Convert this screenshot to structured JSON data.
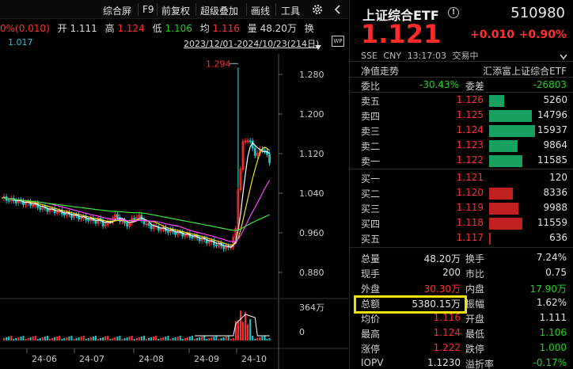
{
  "toolbar": {
    "items": [
      "综合屏",
      "F9",
      "前复权",
      "超级叠加",
      "画线",
      "工具"
    ],
    "settings_icon": "gear-icon",
    "collapse_icon": "chevron-left-icon"
  },
  "quote_line": {
    "change": "0%(0.010)",
    "open_label": "开",
    "open": "1.111",
    "high_label": "高",
    "high": "1.124",
    "low_label": "低",
    "low": "1.106",
    "avg_label": "均",
    "avg": "1.116",
    "vol_label": "量",
    "vol": "48.20万",
    "more": "换"
  },
  "sub_line": {
    "ma_value": "1.017",
    "date_range": "2023/12/01-2024/10/23(214日)"
  },
  "chart": {
    "peak_label": "1.294",
    "y_ticks": [
      "1.280",
      "1.200",
      "1.120",
      "1.040",
      "0.960",
      "0.880"
    ],
    "vol_ticks": [
      "364万",
      "0"
    ],
    "x_ticks": [
      "24-06",
      "24-07",
      "24-08",
      "24-09",
      "24-10"
    ],
    "colors": {
      "up": "#ff3030",
      "down": "#18c8c8",
      "ma5": "#ffffff",
      "ma10": "#f0e020",
      "ma20": "#ff40ff",
      "ma60": "#40e040"
    }
  },
  "right_panel": {
    "title": "上证综合ETF",
    "code": "510980",
    "price": "1.121",
    "change": "+0.010",
    "change_pct": "+0.90%",
    "exchange": "SSE",
    "currency": "CNY",
    "time": "13:17:03",
    "status": "交易中",
    "section": "净值走势",
    "fund_name": "汇添富上证综合ETF",
    "weibi_label": "委比",
    "weibi": "-30.43%",
    "weicha_label": "委差",
    "weicha": "-26803",
    "asks": [
      {
        "label": "卖五",
        "price": "1.126",
        "volume": "5260",
        "ratio": 0.33
      },
      {
        "label": "卖四",
        "price": "1.125",
        "volume": "14796",
        "ratio": 0.93
      },
      {
        "label": "卖三",
        "price": "1.124",
        "volume": "15937",
        "ratio": 1.0
      },
      {
        "label": "卖二",
        "price": "1.123",
        "volume": "9864",
        "ratio": 0.62
      },
      {
        "label": "卖一",
        "price": "1.122",
        "volume": "11585",
        "ratio": 0.73
      }
    ],
    "bids": [
      {
        "label": "买一",
        "price": "1.121",
        "volume": "120",
        "ratio": 0.0
      },
      {
        "label": "买二",
        "price": "1.120",
        "volume": "8336",
        "ratio": 0.52
      },
      {
        "label": "买三",
        "price": "1.119",
        "volume": "9988",
        "ratio": 0.63
      },
      {
        "label": "买四",
        "price": "1.118",
        "volume": "11559",
        "ratio": 0.73
      },
      {
        "label": "买五",
        "price": "1.117",
        "volume": "636",
        "ratio": 0.04
      }
    ],
    "stats": [
      {
        "l1": "总量",
        "v1": "48.20万",
        "c1": "#e0e0e0",
        "l2": "换手",
        "v2": "7.24%",
        "c2": "#e0e0e0"
      },
      {
        "l1": "现手",
        "v1": "200",
        "c1": "#e0e0e0",
        "l2": "市比",
        "v2": "0.75",
        "c2": "#e0e0e0"
      },
      {
        "l1": "外盘",
        "v1": "30.30万",
        "c1": "#ff3030",
        "l2": "内盘",
        "v2": "17.90万",
        "c2": "#20d020"
      },
      {
        "l1": "总额",
        "v1": "5380.15万",
        "c1": "#e0e0e0",
        "l2": "振幅",
        "v2": "1.62%",
        "c2": "#e0e0e0"
      },
      {
        "l1": "均价",
        "v1": "1.116",
        "c1": "#ff3030",
        "l2": "开盘",
        "v2": "1.111",
        "c2": "#e0e0e0"
      },
      {
        "l1": "最高",
        "v1": "1.124",
        "c1": "#ff3030",
        "l2": "最低",
        "v2": "1.106",
        "c2": "#20d020"
      },
      {
        "l1": "涨停",
        "v1": "1.222",
        "c1": "#ff3030",
        "l2": "跌停",
        "v2": "1.000",
        "c2": "#20d020"
      },
      {
        "l1": "IOPV",
        "v1": "1.1230",
        "c1": "#e0e0e0",
        "l2": "溢折率",
        "v2": "-0.17%",
        "c2": "#20d020"
      }
    ]
  }
}
